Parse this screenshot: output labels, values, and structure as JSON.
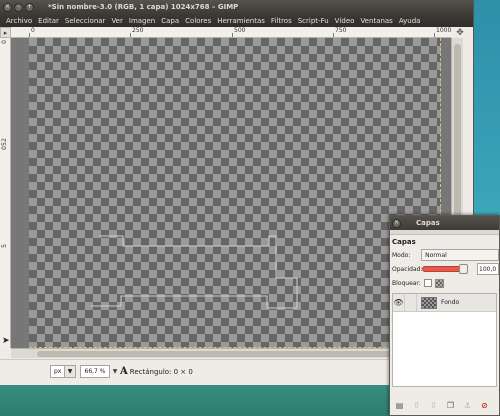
{
  "main_window": {
    "title": "*Sin nombre-3.0 (RGB, 1 capa) 1024x768 – GIMP",
    "menu": [
      "Archivo",
      "Editar",
      "Seleccionar",
      "Ver",
      "Imagen",
      "Capa",
      "Colores",
      "Herramientas",
      "Filtros",
      "Script-Fu",
      "Vídeo",
      "Ventanas",
      "Ayuda"
    ],
    "h_ruler_labels": [
      "0",
      "250",
      "500",
      "750",
      "1000"
    ],
    "v_ruler_labels": [
      "0",
      "2",
      "5",
      "0",
      "5"
    ],
    "status": {
      "unit": "px",
      "zoom": "66,7 %",
      "tool_info": "Rectángulo: 0 × 0"
    }
  },
  "layers_dialog": {
    "title": "Capas",
    "heading": "Capas",
    "mode_label": "Modo:",
    "mode_value": "Normal",
    "opacity_label": "Opacidad:",
    "opacity_value": "100,0",
    "opacity_fraction": 1.0,
    "lock_label": "Bloquear:",
    "layers": [
      {
        "name": "Fondo",
        "visible": true
      }
    ]
  },
  "icons": {
    "close": "close-icon",
    "minimize": "minimize-icon",
    "maximize": "maximize-icon",
    "eye": "eye-icon",
    "new_layer": "new-layer-icon",
    "raise": "raise-layer-icon",
    "lower": "lower-layer-icon",
    "duplicate": "duplicate-layer-icon",
    "anchor": "anchor-layer-icon",
    "delete": "delete-layer-icon"
  }
}
